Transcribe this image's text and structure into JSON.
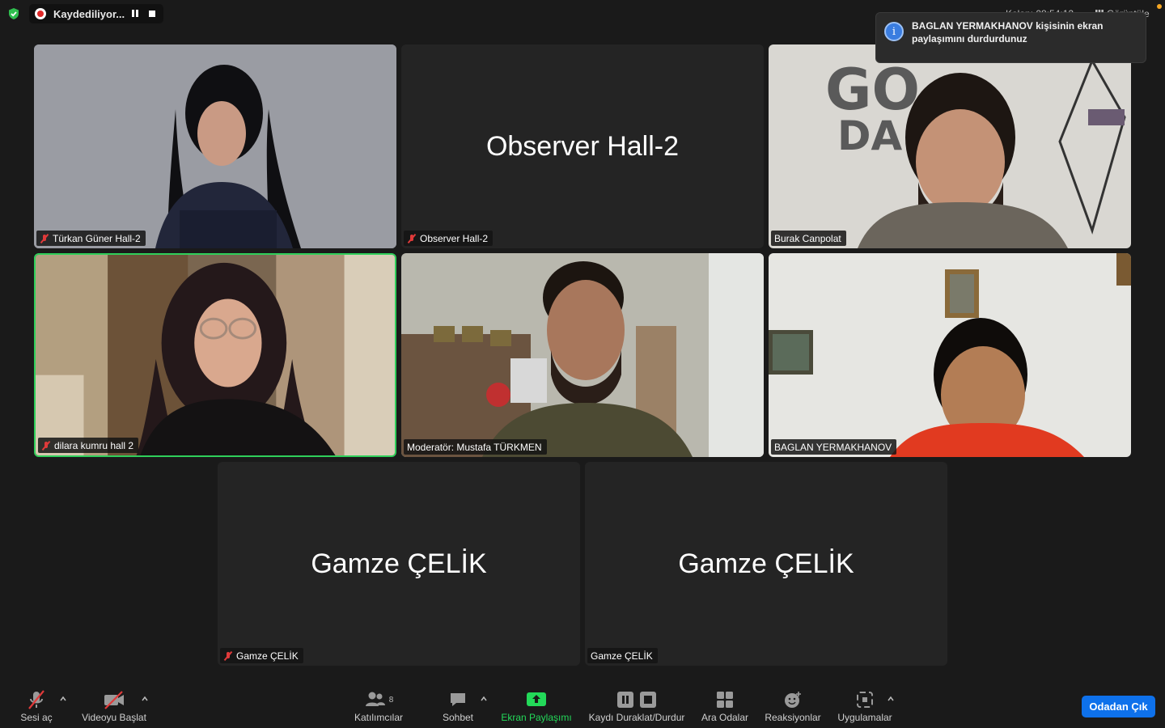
{
  "top": {
    "recording_label": "Kaydediliyor...",
    "timer": "Kalan: 08:54:12",
    "view_label": "Görüntüle"
  },
  "toast": {
    "message": "BAGLAN YERMAKHANOV kişisinin ekran paylaşımını durdurdunuz"
  },
  "participants": [
    {
      "name": "Türkan Güner Hall-2",
      "muted": true,
      "video": true
    },
    {
      "name": "Observer Hall-2",
      "display": "Observer Hall-2",
      "muted": true,
      "video": false
    },
    {
      "name": "Burak Canpolat",
      "muted": false,
      "video": true
    },
    {
      "name": "dilara kumru hall 2",
      "muted": true,
      "video": true,
      "active_speaker": true
    },
    {
      "name": "Moderatör: Mustafa TÜRKMEN",
      "muted": false,
      "video": true
    },
    {
      "name": "BAGLAN YERMAKHANOV",
      "muted": false,
      "video": true
    },
    {
      "name": "Gamze ÇELİK",
      "display": "Gamze ÇELİK",
      "muted": true,
      "video": false
    },
    {
      "name": "Gamze ÇELİK",
      "display": "Gamze ÇELİK",
      "muted": false,
      "video": false
    }
  ],
  "toolbar": {
    "unmute": "Sesi aç",
    "start_video": "Videoyu Başlat",
    "participants": "Katılımcılar",
    "participants_count": "8",
    "chat": "Sohbet",
    "share_screen": "Ekran Paylaşımı",
    "recording_control": "Kaydı Duraklat/Durdur",
    "breakout_rooms": "Ara Odalar",
    "reactions": "Reaksiyonlar",
    "apps": "Uygulamalar",
    "leave": "Odadan Çık"
  },
  "colors": {
    "active_speaker_border": "#2fcf5a",
    "share_green": "#23d959",
    "leave_blue": "#0e71eb",
    "mute_red": "#e03a3a"
  }
}
